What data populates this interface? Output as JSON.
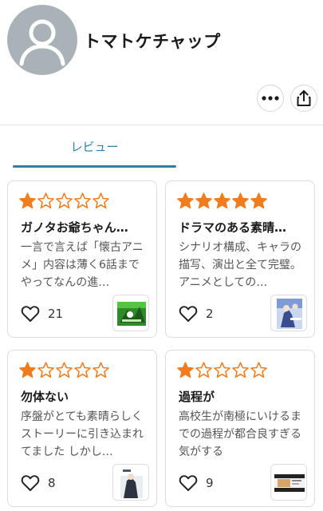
{
  "profile": {
    "username": "トマトケチャップ",
    "avatar_icon": "default-user-icon",
    "more_icon": "more-horizontal-icon",
    "share_icon": "share-icon"
  },
  "tabs": [
    {
      "label": "レビュー",
      "active": true
    }
  ],
  "colors": {
    "accent": "#2d7fa8",
    "star": "#f07c1e",
    "avatar_bg": "#a9b2b7"
  },
  "reviews": [
    {
      "rating": 1,
      "title": "ガノタお爺ちゃん…",
      "body": "一言で言えば「懐古アニメ」内容は薄く6話までやってなんの進…",
      "likes": "21",
      "thumb_icon": "anime-thumbnail-green"
    },
    {
      "rating": 5,
      "title": "ドラマのある素晴…",
      "body": "シナリオ構成、キャラの描写、演出と全て完璧。 アニメとしての…",
      "likes": "2",
      "thumb_icon": "anime-thumbnail-blue"
    },
    {
      "rating": 1,
      "title": "勿体ない",
      "body": "序盤がとても素晴らしくストーリーに引き込まれてました しかし…",
      "likes": "8",
      "thumb_icon": "anime-thumbnail-dark"
    },
    {
      "rating": 1,
      "title": "過程が",
      "body": "高校生が南極にいけるまでの過程が都合良すぎる気がする",
      "likes": "9",
      "thumb_icon": "anime-thumbnail-landscape"
    }
  ]
}
